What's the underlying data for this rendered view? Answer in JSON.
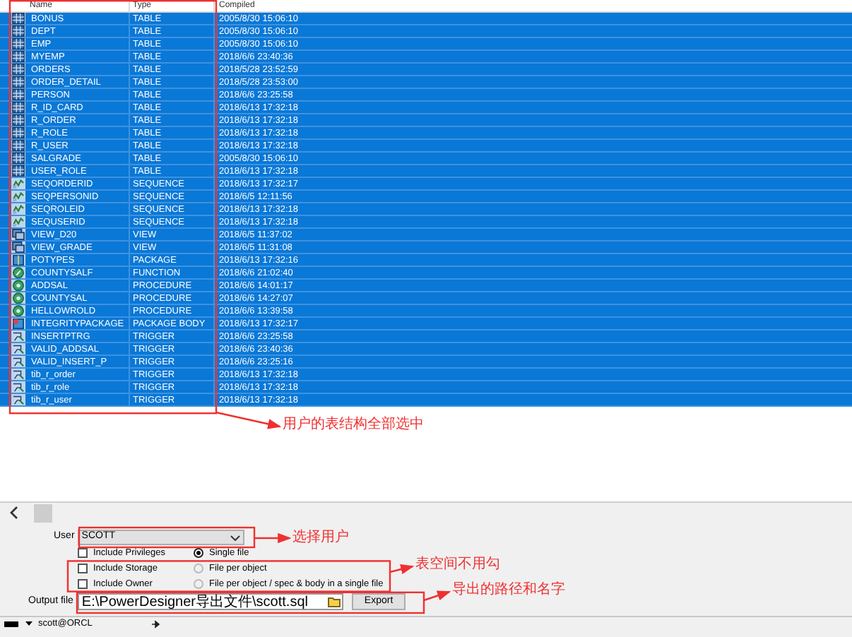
{
  "object_list": {
    "columns": [
      "Name",
      "Type",
      "Compiled"
    ],
    "rows": [
      {
        "kind": "table",
        "name": "BONUS",
        "type": "TABLE",
        "compiled": "2005/8/30 15:06:10",
        "selected": true
      },
      {
        "kind": "table",
        "name": "DEPT",
        "type": "TABLE",
        "compiled": "2005/8/30 15:06:10",
        "selected": true
      },
      {
        "kind": "table",
        "name": "EMP",
        "type": "TABLE",
        "compiled": "2005/8/30 15:06:10",
        "selected": true
      },
      {
        "kind": "table",
        "name": "MYEMP",
        "type": "TABLE",
        "compiled": "2018/6/6 23:40:36",
        "selected": true
      },
      {
        "kind": "table",
        "name": "ORDERS",
        "type": "TABLE",
        "compiled": "2018/5/28 23:52:59",
        "selected": true
      },
      {
        "kind": "table",
        "name": "ORDER_DETAIL",
        "type": "TABLE",
        "compiled": "2018/5/28 23:53:00",
        "selected": true
      },
      {
        "kind": "table",
        "name": "PERSON",
        "type": "TABLE",
        "compiled": "2018/6/6 23:25:58",
        "selected": true
      },
      {
        "kind": "table",
        "name": "R_ID_CARD",
        "type": "TABLE",
        "compiled": "2018/6/13 17:32:18",
        "selected": true
      },
      {
        "kind": "table",
        "name": "R_ORDER",
        "type": "TABLE",
        "compiled": "2018/6/13 17:32:18",
        "selected": true
      },
      {
        "kind": "table",
        "name": "R_ROLE",
        "type": "TABLE",
        "compiled": "2018/6/13 17:32:18",
        "selected": true
      },
      {
        "kind": "table",
        "name": "R_USER",
        "type": "TABLE",
        "compiled": "2018/6/13 17:32:18",
        "selected": true
      },
      {
        "kind": "table",
        "name": "SALGRADE",
        "type": "TABLE",
        "compiled": "2005/8/30 15:06:10",
        "selected": true
      },
      {
        "kind": "table",
        "name": "USER_ROLE",
        "type": "TABLE",
        "compiled": "2018/6/13 17:32:18",
        "selected": true
      },
      {
        "kind": "sequence",
        "name": "SEQORDERID",
        "type": "SEQUENCE",
        "compiled": "2018/6/13 17:32:17",
        "selected": true
      },
      {
        "kind": "sequence",
        "name": "SEQPERSONID",
        "type": "SEQUENCE",
        "compiled": "2018/6/5 12:11:56",
        "selected": true
      },
      {
        "kind": "sequence",
        "name": "SEQROLEID",
        "type": "SEQUENCE",
        "compiled": "2018/6/13 17:32:18",
        "selected": true
      },
      {
        "kind": "sequence",
        "name": "SEQUSERID",
        "type": "SEQUENCE",
        "compiled": "2018/6/13 17:32:18",
        "selected": true
      },
      {
        "kind": "view",
        "name": "VIEW_D20",
        "type": "VIEW",
        "compiled": "2018/6/5 11:37:02",
        "selected": true
      },
      {
        "kind": "view",
        "name": "VIEW_GRADE",
        "type": "VIEW",
        "compiled": "2018/6/5 11:31:08",
        "selected": true
      },
      {
        "kind": "package",
        "name": "POTYPES",
        "type": "PACKAGE",
        "compiled": "2018/6/13 17:32:16",
        "selected": true
      },
      {
        "kind": "function",
        "name": "COUNTYSALF",
        "type": "FUNCTION",
        "compiled": "2018/6/6 21:02:40",
        "selected": true
      },
      {
        "kind": "procedure",
        "name": "ADDSAL",
        "type": "PROCEDURE",
        "compiled": "2018/6/6 14:01:17",
        "selected": true
      },
      {
        "kind": "procedure",
        "name": "COUNTYSAL",
        "type": "PROCEDURE",
        "compiled": "2018/6/6 14:27:07",
        "selected": true
      },
      {
        "kind": "procedure",
        "name": "HELLOWROLD",
        "type": "PROCEDURE",
        "compiled": "2018/6/6 13:39:58",
        "selected": true
      },
      {
        "kind": "package_body",
        "name": "INTEGRITYPACKAGE",
        "type": "PACKAGE BODY",
        "compiled": "2018/6/13 17:32:17",
        "selected": true
      },
      {
        "kind": "trigger",
        "name": "INSERTPTRG",
        "type": "TRIGGER",
        "compiled": "2018/6/6 23:25:58",
        "selected": true
      },
      {
        "kind": "trigger",
        "name": "VALID_ADDSAL",
        "type": "TRIGGER",
        "compiled": "2018/6/6 23:40:36",
        "selected": true
      },
      {
        "kind": "trigger",
        "name": "VALID_INSERT_P",
        "type": "TRIGGER",
        "compiled": "2018/6/6 23:25:16",
        "selected": true
      },
      {
        "kind": "trigger",
        "name": "tib_r_order",
        "type": "TRIGGER",
        "compiled": "2018/6/13 17:32:18",
        "selected": true
      },
      {
        "kind": "trigger",
        "name": "tib_r_role",
        "type": "TRIGGER",
        "compiled": "2018/6/13 17:32:18",
        "selected": true
      },
      {
        "kind": "trigger",
        "name": "tib_r_user",
        "type": "TRIGGER",
        "compiled": "2018/6/13 17:32:18",
        "selected": true
      }
    ]
  },
  "options": {
    "user_label": "User",
    "user_value": "SCOTT",
    "checkboxes": [
      {
        "label": "Include Privileges",
        "checked": false
      },
      {
        "label": "Include Storage",
        "checked": false
      },
      {
        "label": "Include Owner",
        "checked": false
      }
    ],
    "radios": [
      {
        "label": "Single file",
        "selected": true
      },
      {
        "label": "File per object",
        "selected": false
      },
      {
        "label": "File per object / spec & body in a single file",
        "selected": false
      }
    ],
    "output_label": "Output file",
    "output_value": "E:\\PowerDesigner导出文件\\scott.sql",
    "export_button": "Export"
  },
  "status_bar": {
    "connection": "scott@ORCL"
  },
  "annotations": [
    "用户的表结构全部选中",
    "选择用户",
    "表空间不用勾",
    "导出的路径和名字"
  ]
}
